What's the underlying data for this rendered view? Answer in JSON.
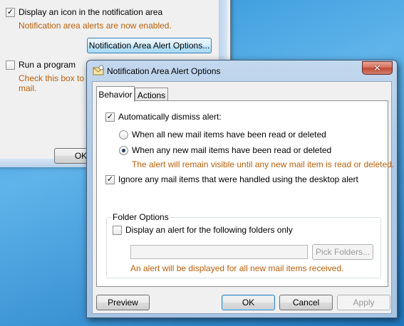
{
  "background_dialog": {
    "display_icon_checkbox": {
      "label": "Display an icon in the notification area",
      "checked": true
    },
    "notification_note": "Notification area alerts are now enabled.",
    "alert_options_button": "Notification Area Alert Options...",
    "run_program_checkbox": {
      "label": "Run a program",
      "checked": false
    },
    "run_program_note_line1": "Check this box to en",
    "run_program_note_line2": "mail.",
    "ok_button": "OK"
  },
  "dialog": {
    "title": "Notification Area Alert Options",
    "close_glyph": "✕",
    "tabs": [
      {
        "label": "Behavior",
        "active": true
      },
      {
        "label": "Actions",
        "active": false
      }
    ],
    "behavior": {
      "auto_dismiss": {
        "label": "Automatically dismiss alert:",
        "checked": true
      },
      "radio_all_read": {
        "label": "When all new mail items have been read or deleted",
        "selected": false
      },
      "radio_any_read": {
        "label": "When any new mail items have been read or deleted",
        "selected": true
      },
      "remain_visible_note": "The alert will remain visible until any new mail item is read or deleted.",
      "ignore_desktop": {
        "label": "Ignore any mail items that were handled using the desktop alert",
        "checked": true
      },
      "folder_options": {
        "title": "Folder Options",
        "folders_only": {
          "label": "Display an alert for the following folders only",
          "checked": false
        },
        "folders_value": "",
        "pick_folders_button": "Pick Folders...",
        "all_items_note": "An alert will be displayed for all new mail items received."
      }
    },
    "buttons": {
      "preview": "Preview",
      "ok": "OK",
      "cancel": "Cancel",
      "apply": "Apply"
    }
  },
  "colors": {
    "note_text": "#b8600b",
    "desktop": "#2a8fd6"
  },
  "icons": {
    "check": "✓",
    "dialog_icon": "mail-alert-icon"
  }
}
